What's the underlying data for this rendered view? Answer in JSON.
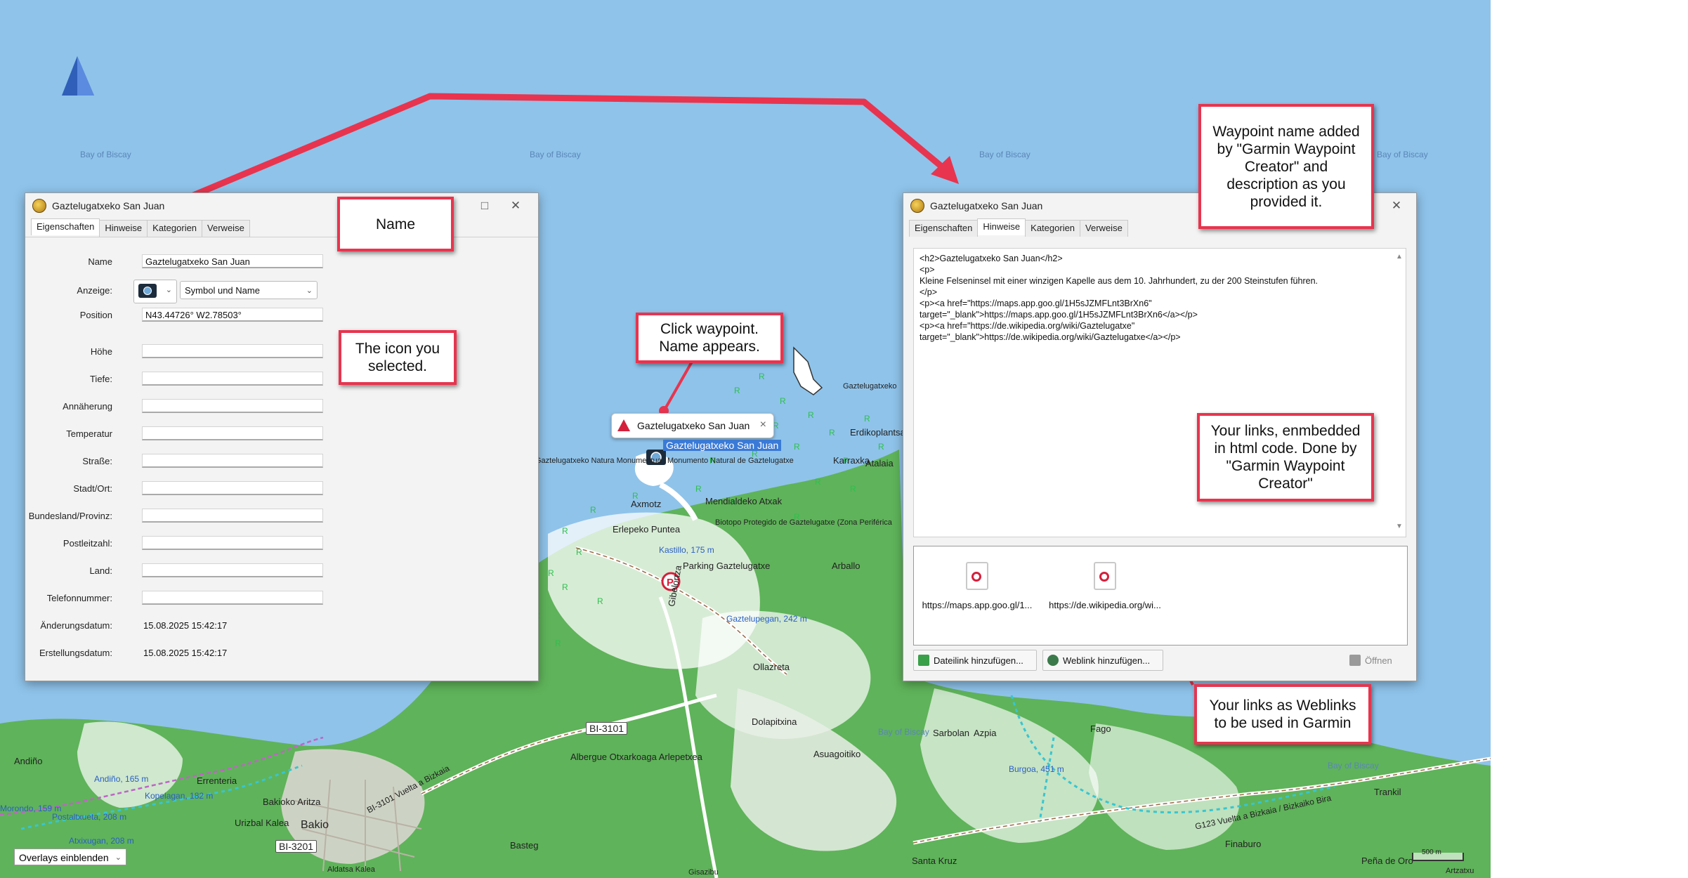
{
  "map": {
    "water_labels": [
      "Bay of Biscay",
      "Bay of Biscay",
      "Bay of Biscay",
      "Bay of Biscay",
      "Bay of Biscay",
      "Bay of Biscay"
    ],
    "place_labels": [
      "Erdikoplantsa",
      "Gaztelugatxeko",
      "Karraxka",
      "Atalaia",
      "Mendialdeko Atxak",
      "Axmotz",
      "Erlepeko Puntea",
      "Biotopo Protegido de Gaztelugatxe (Zona Periférica",
      "Parking Gaztelugatxe",
      "Arballo",
      "Gibelortza",
      "Ollazreta",
      "Dolapitxina",
      "Asuagoitiko",
      "Albergue Otxarkoaga Arlepetxea",
      "Sarbolan",
      "Azpia",
      "Fago",
      "Trankil",
      "Finaburo",
      "Peña de Oro",
      "Santa Kruz",
      "Basteg",
      "Bakio",
      "Bakioko Aritza",
      "Urizbal Kalea",
      "Errenteria",
      "Andiño",
      "Aldatsa Kalea",
      "Gisazibu",
      "Artzatxu",
      "Gaztelugatxeko Natura Monumentua",
      "Monumento Natural de Gaztelugatxe"
    ],
    "peak_labels": [
      "Kastillo, 175 m",
      "Gaztelupegan, 242 m",
      "Burgoa, 451 m",
      "Andiño, 165 m",
      "Kopelagan, 182 m",
      "Postaltxueta, 208 m",
      "Atxixugan, 208 m",
      "Morondo, 159 m"
    ],
    "road_labels": [
      "BI-3101",
      "BI-3201",
      "G123 Vuelta a Bizkaia / Bizkaiko Bira",
      "BI-3101 Vuelta a Bizkaia"
    ],
    "scale_label": "500 m",
    "overlay_button": "Overlays einblenden",
    "popup": {
      "title": "Gaztelugatxeko San Juan",
      "close": "×"
    },
    "waypoint_label": "Gaztelugatxeko San Juan"
  },
  "left_dialog": {
    "title": "Gaztelugatxeko San Juan",
    "tabs": [
      "Eigenschaften",
      "Hinweise",
      "Kategorien",
      "Verweise"
    ],
    "fields": {
      "name_label": "Name",
      "name_value": "Gaztelugatxeko San Juan",
      "anzeige_label": "Anzeige:",
      "anzeige_value": "Symbol und Name",
      "position_label": "Position",
      "position_value": "N43.44726° W2.78503°",
      "hoehe_label": "Höhe",
      "tiefe_label": "Tiefe:",
      "annaeherung_label": "Annäherung",
      "temperatur_label": "Temperatur",
      "strasse_label": "Straße:",
      "stadt_label": "Stadt/Ort:",
      "bundesland_label": "Bundesland/Provinz:",
      "plz_label": "Postleitzahl:",
      "land_label": "Land:",
      "telefon_label": "Telefonnummer:",
      "aenderung_label": "Änderungsdatum:",
      "aenderung_value": "15.08.2025 15:42:17",
      "erstellung_label": "Erstellungsdatum:",
      "erstellung_value": "15.08.2025 15:42:17"
    }
  },
  "right_dialog": {
    "title": "Gaztelugatxeko San Juan",
    "tabs": [
      "Eigenschaften",
      "Hinweise",
      "Kategorien",
      "Verweise"
    ],
    "notes_lines": [
      "<h2>Gaztelugatxeko San Juan</h2>",
      "<p>",
      "Kleine Felseninsel mit einer winzigen Kapelle aus dem 10. Jahrhundert, zu der 200 Steinstufen führen.",
      "</p>",
      "<p><a href=\"https://maps.app.goo.gl/1H5sJZMFLnt3BrXn6\"",
      "target=\"_blank\">https://maps.app.goo.gl/1H5sJZMFLnt3BrXn6</a></p>",
      "<p><a href=\"https://de.wikipedia.org/wiki/Gaztelugatxe\"",
      "target=\"_blank\">https://de.wikipedia.org/wiki/Gaztelugatxe</a></p>"
    ],
    "weblinks": [
      "https://maps.app.goo.gl/1...",
      "https://de.wikipedia.org/wi..."
    ],
    "buttons": {
      "dateilink": "Dateilink hinzufügen...",
      "weblink": "Weblink hinzufügen...",
      "oeffnen": "Öffnen"
    }
  },
  "callouts": {
    "name": "Name",
    "icon": "The icon you\nselected.",
    "click": "Click waypoint.\nName appears.",
    "waypoint_name": "Waypoint name added\nby  \"Garmin Waypoint\nCreator\" and\ndescription as you\nprovided it.",
    "links_html": "Your links, enmbedded\nin html code. Done by\n\"Garmin Waypoint\nCreator\"",
    "weblinks": "Your links as Weblinks\nto be used in Garmin"
  },
  "colors": {
    "callout_border": "#e8344e",
    "water": "#8fc3ea",
    "land": "#5fb35a"
  }
}
